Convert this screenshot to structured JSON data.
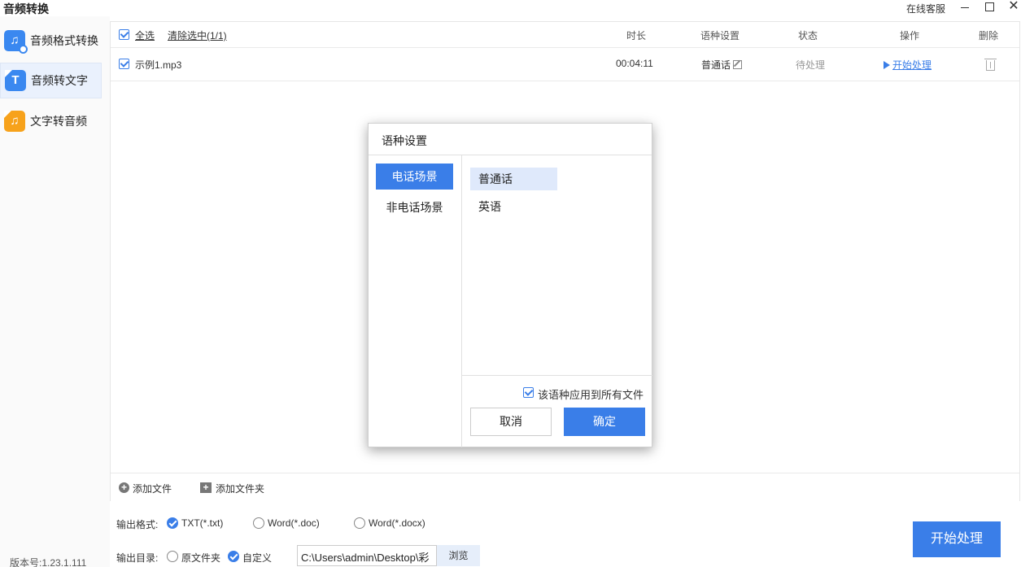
{
  "app": {
    "title": "音频转换",
    "support": "在线客服"
  },
  "sidebar": {
    "items": [
      {
        "label": "音频格式转换",
        "icon": "music-convert-icon"
      },
      {
        "label": "音频转文字",
        "icon": "audio-to-text-icon",
        "active": true
      },
      {
        "label": "文字转音频",
        "icon": "text-to-audio-icon"
      }
    ],
    "version": "版本号:1.23.1.111"
  },
  "table": {
    "select_all": "全选",
    "clear_selected": "清除选中(1/1)",
    "headers": {
      "duration": "时长",
      "language": "语种设置",
      "status": "状态",
      "action": "操作",
      "delete": "删除"
    },
    "rows": [
      {
        "name": "示例1.mp3",
        "duration": "00:04:11",
        "language": "普通话",
        "status": "待处理",
        "action": "开始处理"
      }
    ]
  },
  "footer": {
    "add_file": "添加文件",
    "add_folder": "添加文件夹"
  },
  "output": {
    "format_label": "输出格式:",
    "formats": [
      "TXT(*.txt)",
      "Word(*.doc)",
      "Word(*.docx)"
    ],
    "selected_format": "TXT(*.txt)",
    "dir_label": "输出目录:",
    "dir_options": [
      "原文件夹",
      "自定义"
    ],
    "selected_dir": "自定义",
    "path": "C:\\Users\\admin\\Desktop\\彩",
    "browse": "浏览",
    "start": "开始处理"
  },
  "dialog": {
    "title": "语种设置",
    "scenes": [
      "电话场景",
      "非电话场景"
    ],
    "active_scene": "电话场景",
    "languages": [
      "普通话",
      "英语"
    ],
    "active_language": "普通话",
    "apply_all": "该语种应用到所有文件",
    "cancel": "取消",
    "ok": "确定"
  },
  "colors": {
    "accent": "#3a7ee8",
    "icon_blue": "#3a88f0",
    "icon_orange": "#f7a21b"
  }
}
